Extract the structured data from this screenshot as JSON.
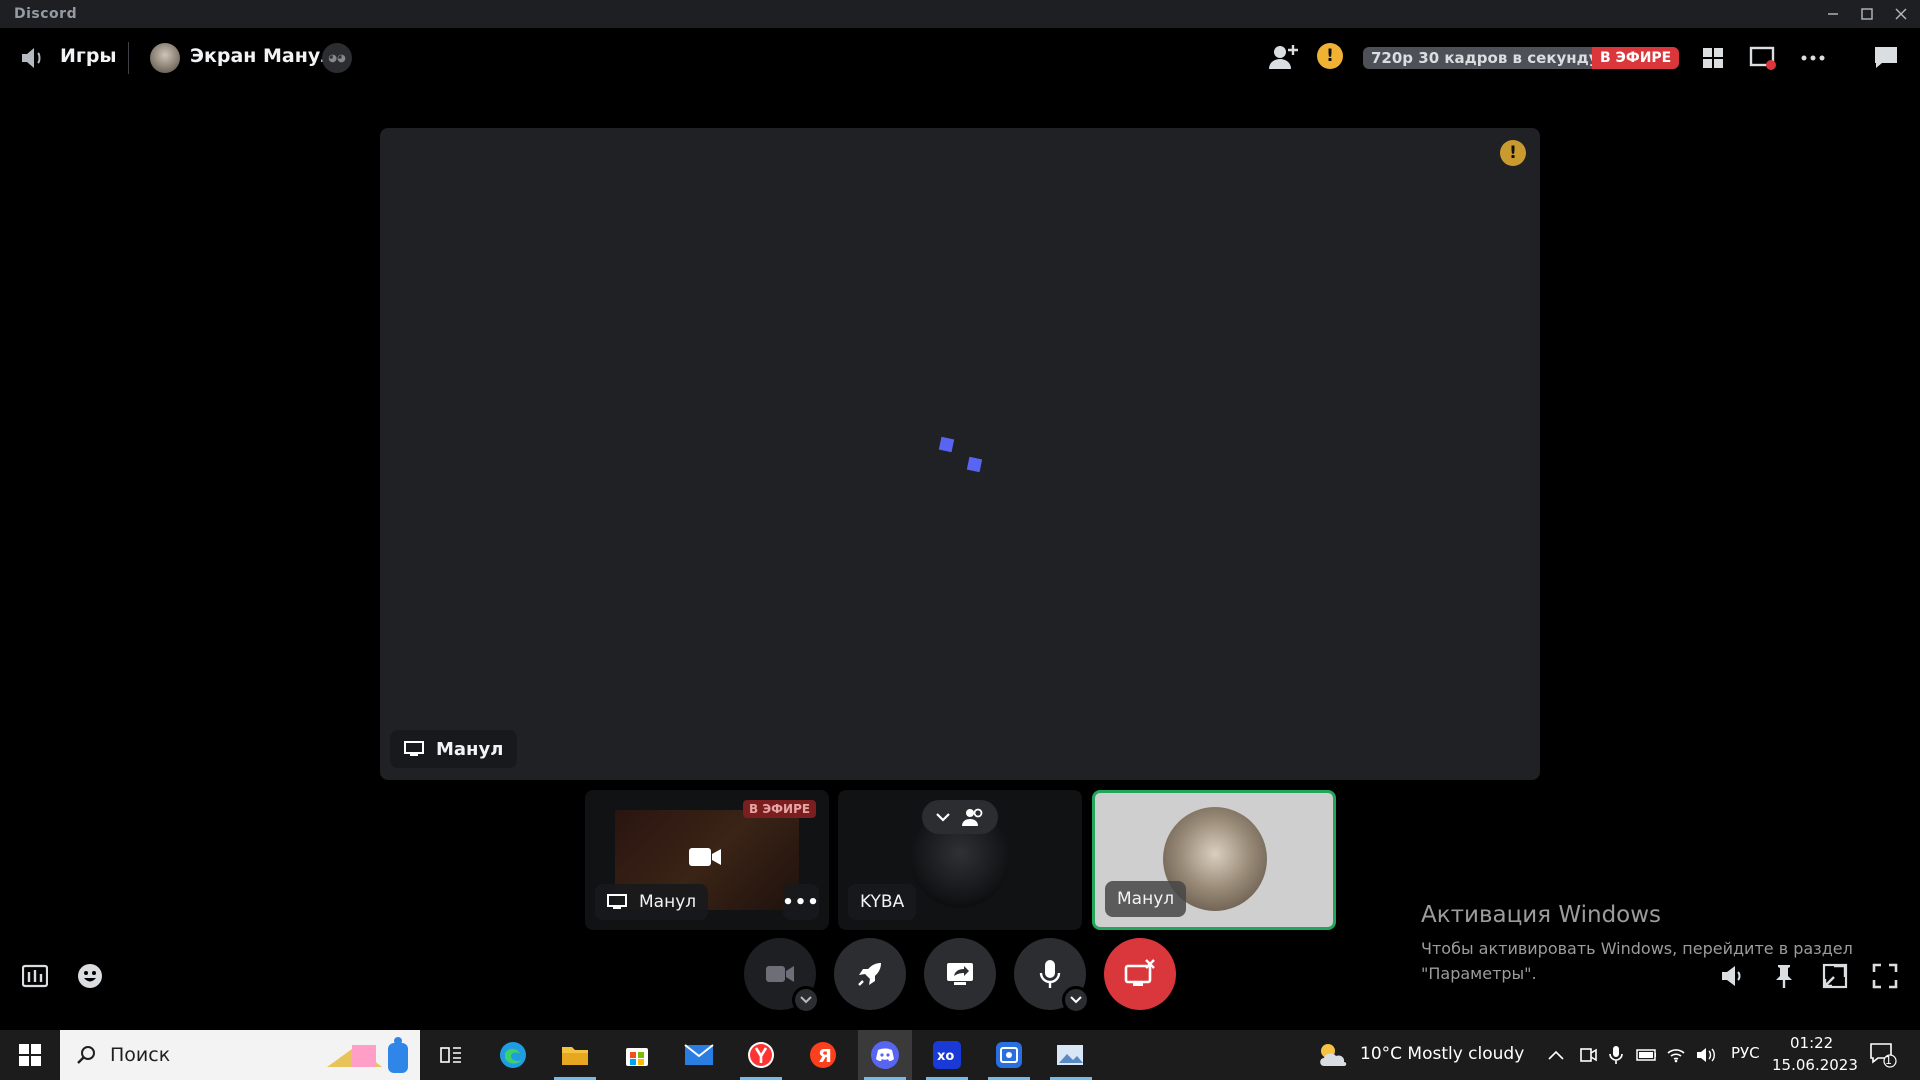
{
  "window": {
    "title": "Discord"
  },
  "topbar": {
    "channel_name": "Игры",
    "screen_title": "Экран Манул",
    "quality": "720p 30 кадров в секунду",
    "live_badge": "В ЭФИРЕ"
  },
  "stage": {
    "streamer_label": "Манул"
  },
  "tiles": [
    {
      "label": "Манул",
      "live_badge": "В ЭФИРЕ",
      "more": "•••"
    },
    {
      "label": "KYBA"
    },
    {
      "label": "Манул"
    }
  ],
  "activation": {
    "title": "Активация Windows",
    "line1": "Чтобы активировать Windows, перейдите в раздел",
    "line2": "\"Параметры\"."
  },
  "taskbar": {
    "search_placeholder": "Поиск",
    "weather": "10°C  Mostly cloudy",
    "lang": "РУС",
    "time": "01:22",
    "date": "15.06.2023",
    "notif_count": "1"
  },
  "colors": {
    "accent": "#5865f2",
    "live_red": "#da373c",
    "speaking_green": "#23a55a",
    "warn_yellow": "#f0b232"
  }
}
